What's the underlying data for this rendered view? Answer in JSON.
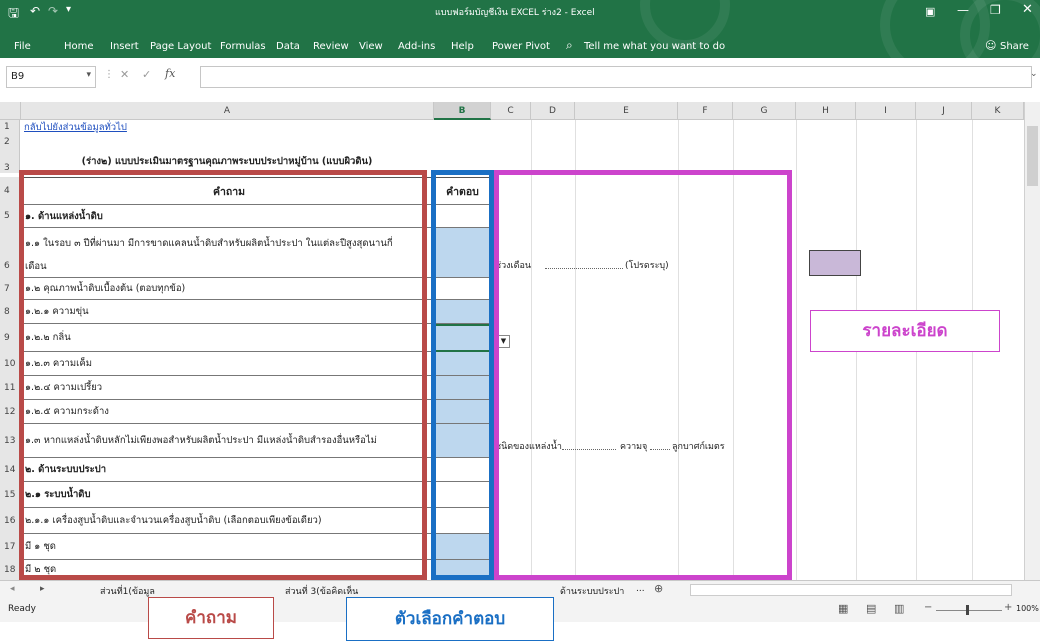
{
  "window": {
    "title": "แบบฟอร์มบัญชีเงิน EXCEL ร่าง2  -  Excel",
    "share_label": "Share",
    "tell_me": "Tell me what you want to do"
  },
  "ribbon_tabs": [
    "File",
    "Home",
    "Insert",
    "Page Layout",
    "Formulas",
    "Data",
    "Review",
    "View",
    "Add-ins",
    "Help",
    "Power Pivot"
  ],
  "formula_bar": {
    "name_box": "B9",
    "fx": "fx",
    "formula": ""
  },
  "columns": [
    "A",
    "B",
    "C",
    "D",
    "E",
    "F",
    "G",
    "H",
    "I",
    "J",
    "K"
  ],
  "rows": [
    {
      "num": "1",
      "a": "กลับไปยังส่วนข้อมูลทั่วไป",
      "type": "link"
    },
    {
      "num": "2",
      "a": "",
      "type": "blank"
    },
    {
      "num": "3",
      "a": "(ร่าง๒) แบบประเมินมาตรฐานคุณภาพระบบประปาหมู่บ้าน (แบบผิวดิน)",
      "type": "title"
    },
    {
      "num": "4",
      "a": "คำถาม",
      "b": "คำตอบ",
      "type": "header"
    },
    {
      "num": "5",
      "a": "๑. ด้านแหล่งน้ำดิบ",
      "type": "section"
    },
    {
      "num": "6",
      "a": "๑.๑ ในรอบ ๓ ปีที่ผ่านมา มีการขาดแคลนน้ำดิบสำหรับผลิตน้ำประปา ในแต่ละปีสูงสุดนานกี่",
      "a2": "เดือน",
      "type": "q2",
      "answer": true
    },
    {
      "num": "7",
      "a": "๑.๒ คุณภาพน้ำดิบเบื้องต้น (ตอบทุกข้อ)",
      "type": "q"
    },
    {
      "num": "8",
      "a": "๑.๒.๑ ความขุ่น",
      "type": "q",
      "answer": true
    },
    {
      "num": "9",
      "a": "๑.๒.๒ กลิ่น",
      "type": "q",
      "answer": true
    },
    {
      "num": "10",
      "a": "๑.๒.๓ ความเค็ม",
      "type": "q",
      "answer": true
    },
    {
      "num": "11",
      "a": "๑.๒.๔ ความเปรี้ยว",
      "type": "q",
      "answer": true
    },
    {
      "num": "12",
      "a": "๑.๒.๕ ความกระด้าง",
      "type": "q",
      "answer": true
    },
    {
      "num": "13",
      "a": "๑.๓ หากแหล่งน้ำดิบหลักไม่เพียงพอสำหรับผลิตน้ำประปา มีแหล่งน้ำดิบสำรองอื่นหรือไม่",
      "type": "q",
      "answer": true
    },
    {
      "num": "14",
      "a": "๒. ด้านระบบประปา",
      "type": "section"
    },
    {
      "num": "15",
      "a": "๒.๑ ระบบน้ำดิบ",
      "type": "section"
    },
    {
      "num": "16",
      "a": "๒.๑.๑ เครื่องสูบน้ำดิบและจำนวนเครื่องสูบน้ำดิบ (เลือกตอบเพียงข้อเดียว)",
      "type": "q"
    },
    {
      "num": "17",
      "a": "มี ๑ ชุด",
      "type": "q",
      "answer": true
    },
    {
      "num": "18",
      "a": "มี ๒ ชุด",
      "type": "q",
      "answer": true
    }
  ],
  "details": {
    "r6_label": "ช่วงเดือน",
    "r6_note": "(โปรดระบุ)",
    "r13_label": "ชนิดของแหล่งน้ำ",
    "r13_depth": "ความจุ",
    "r13_unit": "ลูกบาศก์เมตร"
  },
  "sheet_tabs": [
    "ส่วนที่1(ข้อมูล",
    "ส่วนที่ 3(ข้อคิดเห็น",
    "ด้านระบบประปา",
    "..."
  ],
  "status": {
    "ready": "Ready",
    "zoom": "100%"
  },
  "annotations": {
    "question": "คำถาม",
    "answer_choice": "ตัวเลือกคำตอบ",
    "detail": "รายละเอียด"
  },
  "colors": {
    "excel_green": "#217346",
    "question_box": "#b94a48",
    "answer_box": "#1a6fc4",
    "detail_box": "#cc44cc",
    "answer_fill": "#bdd7ee",
    "purple_cell": "#c9b8d8"
  }
}
